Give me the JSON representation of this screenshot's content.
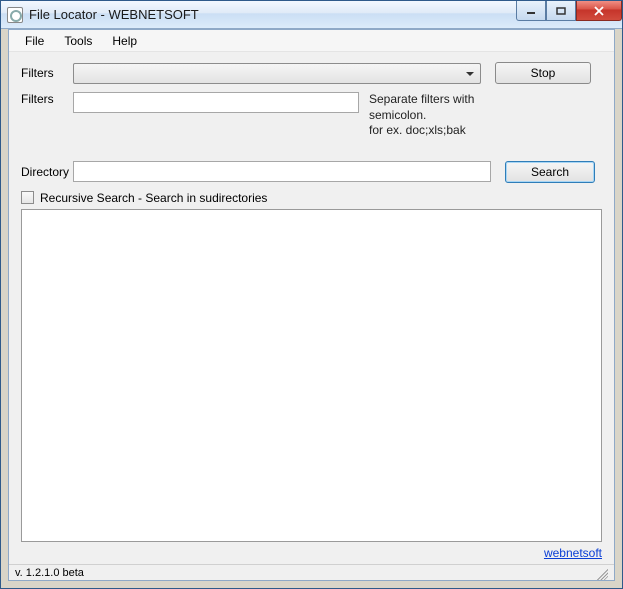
{
  "window": {
    "title": "File Locator - WEBNETSOFT"
  },
  "menu": {
    "file": "File",
    "tools": "Tools",
    "help": "Help"
  },
  "labels": {
    "filters_combo": "Filters",
    "filters_text": "Filters",
    "directory": "Directory",
    "recursive": "Recursive Search - Search in sudirectories"
  },
  "hint": {
    "line1": "Separate filters with semicolon.",
    "line2": "for ex. doc;xls;bak"
  },
  "buttons": {
    "stop": "Stop",
    "search": "Search"
  },
  "fields": {
    "filters_combo_value": "",
    "filters_text_value": "",
    "directory_value": "",
    "recursive_checked": false
  },
  "link": {
    "webnetsoft": "webnetsoft"
  },
  "status": {
    "version": "v. 1.2.1.0 beta"
  }
}
